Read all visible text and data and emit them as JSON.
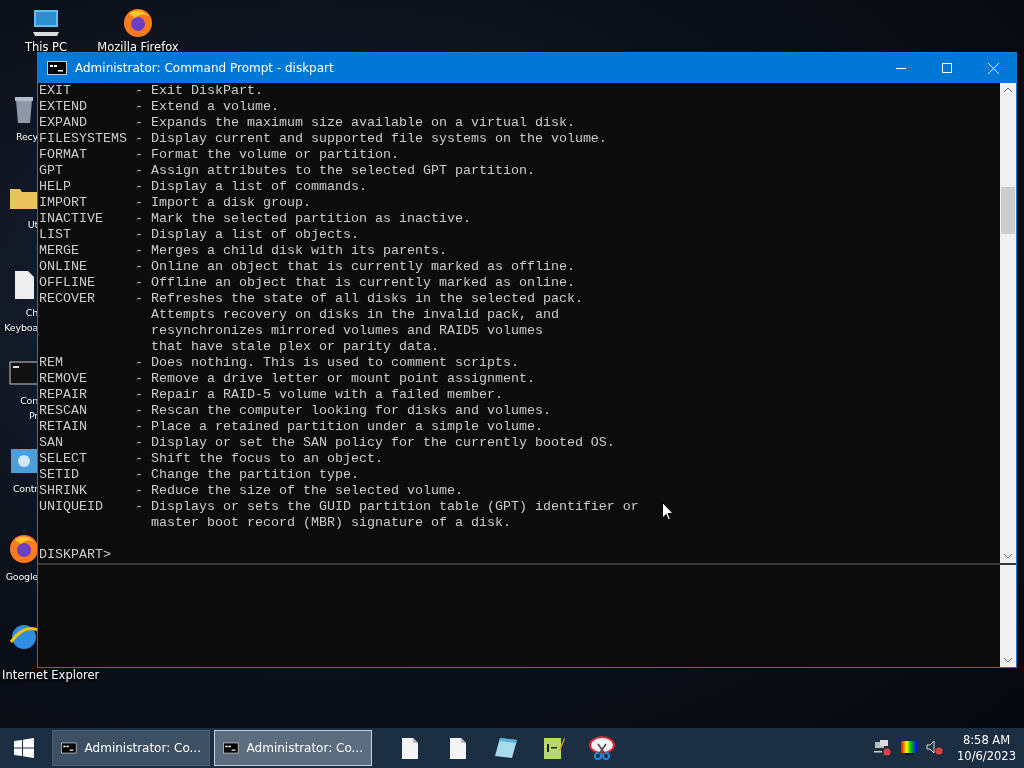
{
  "desktop_icons": [
    {
      "kind": "computer",
      "lines": [
        "This PC"
      ]
    },
    {
      "kind": "browser",
      "lines": [
        "Mozilla Firefox"
      ]
    },
    {
      "kind": "trash",
      "lines": [
        "Recy"
      ]
    },
    {
      "kind": "folder",
      "lines": [
        "Ut"
      ]
    },
    {
      "kind": "file",
      "lines": [
        "Ch",
        "Keyboa"
      ]
    },
    {
      "kind": "console",
      "lines": [
        "Con",
        "Pr"
      ]
    },
    {
      "kind": "panel",
      "lines": [
        "Contr"
      ]
    },
    {
      "kind": "browser",
      "lines": [
        "Google"
      ]
    },
    {
      "kind": "globe",
      "lines": [
        "Internet Explorer"
      ]
    }
  ],
  "window": {
    "title": "Administrator: Command Prompt - diskpart",
    "console_lines": [
      "EXIT        - Exit DiskPart.",
      "EXTEND      - Extend a volume.",
      "EXPAND      - Expands the maximum size available on a virtual disk.",
      "FILESYSTEMS - Display current and supported file systems on the volume.",
      "FORMAT      - Format the volume or partition.",
      "GPT         - Assign attributes to the selected GPT partition.",
      "HELP        - Display a list of commands.",
      "IMPORT      - Import a disk group.",
      "INACTIVE    - Mark the selected partition as inactive.",
      "LIST        - Display a list of objects.",
      "MERGE       - Merges a child disk with its parents.",
      "ONLINE      - Online an object that is currently marked as offline.",
      "OFFLINE     - Offline an object that is currently marked as online.",
      "RECOVER     - Refreshes the state of all disks in the selected pack.",
      "              Attempts recovery on disks in the invalid pack, and",
      "              resynchronizes mirrored volumes and RAID5 volumes",
      "              that have stale plex or parity data.",
      "REM         - Does nothing. This is used to comment scripts.",
      "REMOVE      - Remove a drive letter or mount point assignment.",
      "REPAIR      - Repair a RAID-5 volume with a failed member.",
      "RESCAN      - Rescan the computer looking for disks and volumes.",
      "RETAIN      - Place a retained partition under a simple volume.",
      "SAN         - Display or set the SAN policy for the currently booted OS.",
      "SELECT      - Shift the focus to an object.",
      "SETID       - Change the partition type.",
      "SHRINK      - Reduce the size of the selected volume.",
      "UNIQUEID    - Displays or sets the GUID partition table (GPT) identifier or",
      "              master boot record (MBR) signature of a disk."
    ],
    "prompt": "DISKPART>"
  },
  "taskbar": {
    "tasks": [
      {
        "label": "Administrator: Co...",
        "selected": false
      },
      {
        "label": "Administrator: Co...",
        "selected": true
      }
    ],
    "pinned": [
      {
        "kind": "file"
      },
      {
        "kind": "file"
      },
      {
        "kind": "notepad"
      },
      {
        "kind": "editor"
      },
      {
        "kind": "scissors"
      }
    ],
    "clock": {
      "time": "8:58 AM",
      "date": "10/6/2023"
    }
  }
}
